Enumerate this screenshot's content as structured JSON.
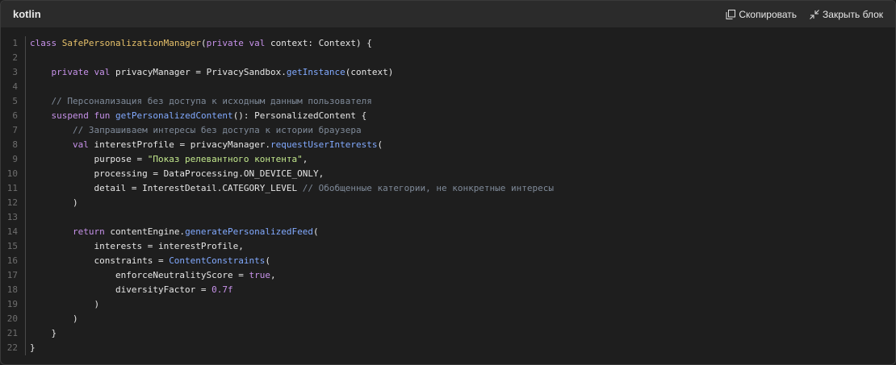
{
  "header": {
    "language": "kotlin",
    "copy_label": "Скопировать",
    "close_label": "Закрыть блок"
  },
  "code_lines": [
    {
      "n": "1",
      "parts": [
        [
          "kw",
          "class "
        ],
        [
          "cls",
          "SafePersonalizationManager"
        ],
        [
          "txt",
          "("
        ],
        [
          "kw",
          "private val "
        ],
        [
          "txt",
          "context: Context) {"
        ]
      ]
    },
    {
      "n": "2",
      "parts": []
    },
    {
      "n": "3",
      "parts": [
        [
          "txt",
          "    "
        ],
        [
          "kw",
          "private val "
        ],
        [
          "txt",
          "privacyManager = PrivacySandbox."
        ],
        [
          "fn",
          "getInstance"
        ],
        [
          "txt",
          "(context)"
        ]
      ]
    },
    {
      "n": "4",
      "parts": []
    },
    {
      "n": "5",
      "parts": [
        [
          "txt",
          "    "
        ],
        [
          "cmt",
          "// Персонализация без доступа к исходным данным пользователя"
        ]
      ]
    },
    {
      "n": "6",
      "parts": [
        [
          "txt",
          "    "
        ],
        [
          "kw",
          "suspend fun "
        ],
        [
          "fn",
          "getPersonalizedContent"
        ],
        [
          "txt",
          "(): PersonalizedContent {"
        ]
      ]
    },
    {
      "n": "7",
      "parts": [
        [
          "txt",
          "        "
        ],
        [
          "cmt",
          "// Запрашиваем интересы без доступа к истории браузера"
        ]
      ]
    },
    {
      "n": "8",
      "parts": [
        [
          "txt",
          "        "
        ],
        [
          "kw",
          "val "
        ],
        [
          "txt",
          "interestProfile = privacyManager."
        ],
        [
          "fn",
          "requestUserInterests"
        ],
        [
          "txt",
          "("
        ]
      ]
    },
    {
      "n": "9",
      "parts": [
        [
          "txt",
          "            purpose = "
        ],
        [
          "str",
          "\"Показ релевантного контента\""
        ],
        [
          "txt",
          ","
        ]
      ]
    },
    {
      "n": "10",
      "parts": [
        [
          "txt",
          "            processing = DataProcessing.ON_DEVICE_ONLY,"
        ]
      ]
    },
    {
      "n": "11",
      "parts": [
        [
          "txt",
          "            detail = InterestDetail.CATEGORY_LEVEL "
        ],
        [
          "cmt",
          "// Обобщенные категории, не конкретные интересы"
        ]
      ]
    },
    {
      "n": "12",
      "parts": [
        [
          "txt",
          "        )"
        ]
      ]
    },
    {
      "n": "13",
      "parts": []
    },
    {
      "n": "14",
      "parts": [
        [
          "txt",
          "        "
        ],
        [
          "kw",
          "return "
        ],
        [
          "txt",
          "contentEngine."
        ],
        [
          "fn",
          "generatePersonalizedFeed"
        ],
        [
          "txt",
          "("
        ]
      ]
    },
    {
      "n": "15",
      "parts": [
        [
          "txt",
          "            interests = interestProfile,"
        ]
      ]
    },
    {
      "n": "16",
      "parts": [
        [
          "txt",
          "            constraints = "
        ],
        [
          "fn",
          "ContentConstraints"
        ],
        [
          "txt",
          "("
        ]
      ]
    },
    {
      "n": "17",
      "parts": [
        [
          "txt",
          "                enforceNeutralityScore = "
        ],
        [
          "kw",
          "true"
        ],
        [
          "txt",
          ","
        ]
      ]
    },
    {
      "n": "18",
      "parts": [
        [
          "txt",
          "                diversityFactor = "
        ],
        [
          "num",
          "0.7f"
        ]
      ]
    },
    {
      "n": "19",
      "parts": [
        [
          "txt",
          "            )"
        ]
      ]
    },
    {
      "n": "20",
      "parts": [
        [
          "txt",
          "        )"
        ]
      ]
    },
    {
      "n": "21",
      "parts": [
        [
          "txt",
          "    }"
        ]
      ]
    },
    {
      "n": "22",
      "parts": [
        [
          "txt",
          "}"
        ]
      ]
    }
  ],
  "icons": {
    "copy": "copy-icon",
    "close": "collapse-icon"
  },
  "colors": {
    "background": "#1e1e1e",
    "header": "#2b2b2b",
    "keyword": "#c792ea",
    "class": "#e7c16a",
    "function": "#82aaff",
    "string": "#c3e88d",
    "comment": "#7f8a99"
  }
}
